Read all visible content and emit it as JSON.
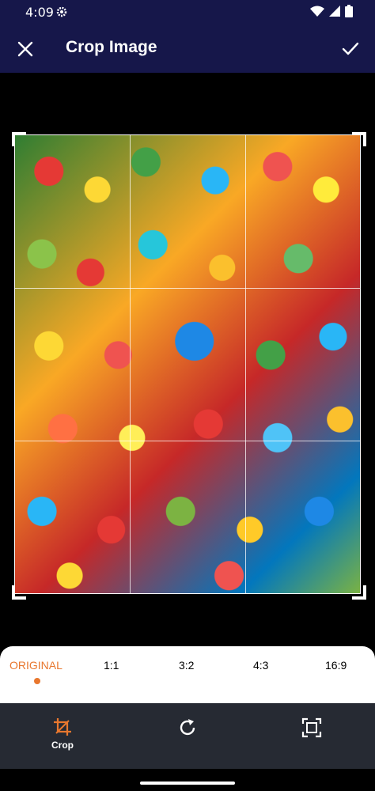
{
  "status_bar": {
    "time": "4:09"
  },
  "app_bar": {
    "title": "Crop Image"
  },
  "aspect_ratios": {
    "selected": "ORIGINAL",
    "options": [
      "ORIGINAL",
      "1:1",
      "3:2",
      "4:3",
      "16:9"
    ]
  },
  "tools": {
    "crop_label": "Crop"
  },
  "colors": {
    "app_bar_bg": "#16174a",
    "accent": "#e8772e",
    "bottom_bar_bg": "#262a33"
  },
  "icons": [
    "settings-icon",
    "wifi-icon",
    "signal-icon",
    "battery-icon",
    "close-icon",
    "check-icon",
    "crop-icon",
    "rotate-icon",
    "fit-screen-icon"
  ]
}
